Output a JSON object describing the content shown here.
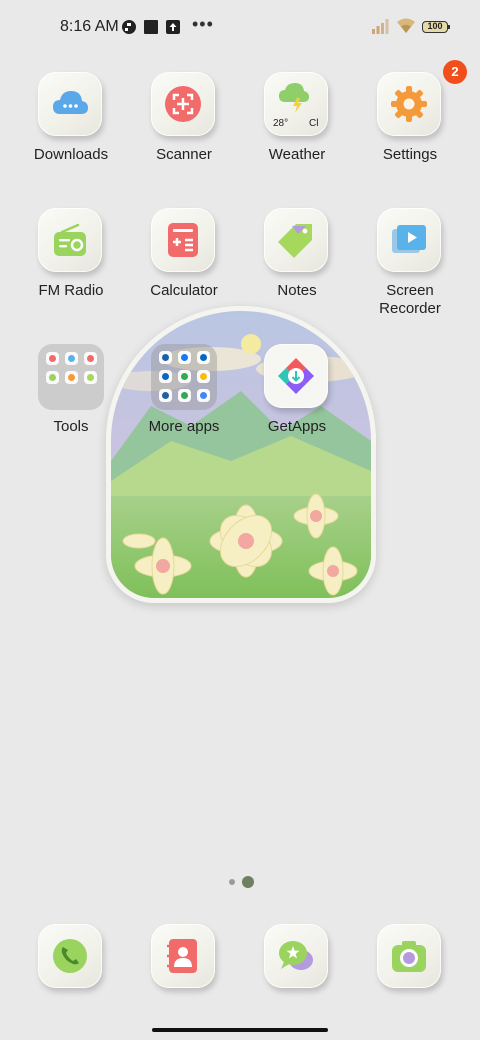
{
  "status_bar": {
    "time": "8:16 AM",
    "battery_level": "100",
    "icons": [
      "notification-app-icon",
      "stop-square-icon",
      "upload-icon",
      "more-dots-icon",
      "signal-icon",
      "wifi-icon",
      "battery-icon"
    ]
  },
  "row1": [
    {
      "label": "Downloads",
      "icon": "cloud-download-icon",
      "color": "#5aa8e8"
    },
    {
      "label": "Scanner",
      "icon": "scanner-icon",
      "color": "#f26b6b"
    },
    {
      "label": "Weather",
      "icon": "weather-icon",
      "temp": "28°",
      "condition": "Cl",
      "color": "#8fcf6a"
    },
    {
      "label": "Settings",
      "icon": "gear-icon",
      "badge": "2",
      "color": "#f59a3a"
    }
  ],
  "row2": [
    {
      "label": "FM Radio",
      "icon": "radio-icon",
      "color": "#9bd35f"
    },
    {
      "label": "Calculator",
      "icon": "calculator-icon",
      "color": "#f26b6b"
    },
    {
      "label": "Notes",
      "icon": "tag-note-icon",
      "color": "#a6d85e"
    },
    {
      "label": "Screen\nRecorder",
      "icon": "screen-recorder-icon",
      "color": "#59b3ea"
    }
  ],
  "row3": [
    {
      "label": "Tools",
      "type": "folder"
    },
    {
      "label": "More apps",
      "type": "folder"
    },
    {
      "label": "GetApps",
      "icon": "getapps-icon"
    }
  ],
  "page_indicator": {
    "pages": 2,
    "current": 2
  },
  "dock": [
    {
      "name": "phone",
      "icon": "phone-icon",
      "color": "#9bd35f"
    },
    {
      "name": "contacts",
      "icon": "contacts-icon",
      "color": "#f26b6b"
    },
    {
      "name": "messages",
      "icon": "messages-icon",
      "color": "#9bd35f"
    },
    {
      "name": "camera",
      "icon": "camera-icon",
      "color": "#9bd35f"
    }
  ]
}
